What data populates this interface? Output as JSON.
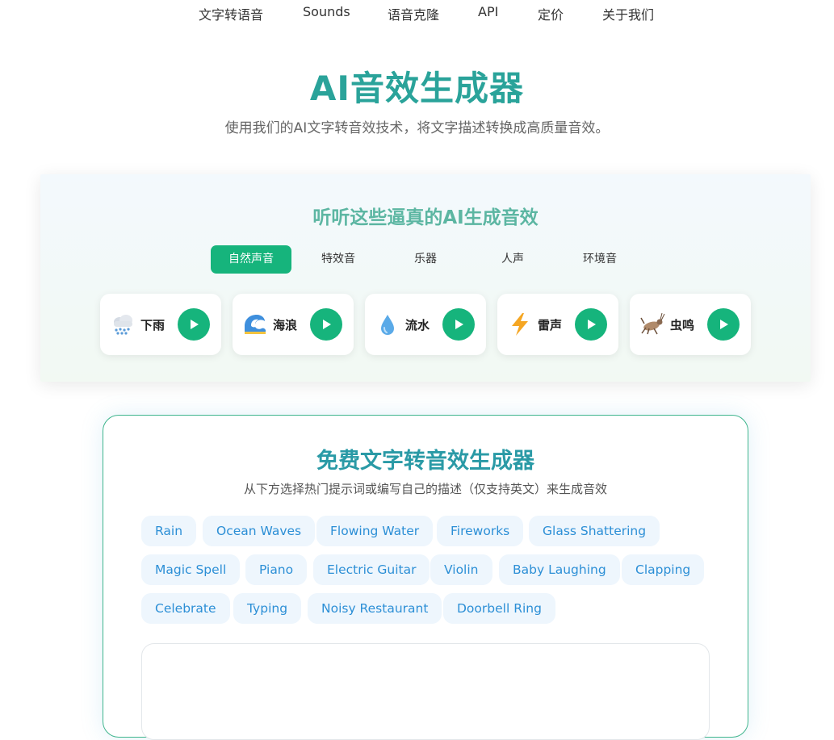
{
  "nav": {
    "items": [
      {
        "label": "文字转语音"
      },
      {
        "label": "Sounds"
      },
      {
        "label": "语音克隆"
      },
      {
        "label": "API"
      },
      {
        "label": "定价"
      },
      {
        "label": "关于我们"
      }
    ]
  },
  "hero": {
    "title": "AI音效生成器",
    "subtitle": "使用我们的AI文字转音效技术，将文字描述转换成高质量音效。"
  },
  "demo": {
    "title": "听听这些逼真的AI生成音效",
    "tabs": [
      {
        "label": "自然声音",
        "active": true
      },
      {
        "label": "特效音",
        "active": false
      },
      {
        "label": "乐器",
        "active": false
      },
      {
        "label": "人声",
        "active": false
      },
      {
        "label": "环境音",
        "active": false
      }
    ],
    "cards": [
      {
        "label": "下雨",
        "icon": "rain-cloud-icon"
      },
      {
        "label": "海浪",
        "icon": "wave-icon"
      },
      {
        "label": "流水",
        "icon": "droplet-icon"
      },
      {
        "label": "雷声",
        "icon": "lightning-icon"
      },
      {
        "label": "虫鸣",
        "icon": "cricket-icon"
      }
    ]
  },
  "generator": {
    "title": "免费文字转音效生成器",
    "subtitle": "从下方选择热门提示词或编写自己的描述（仅支持英文）来生成音效",
    "prompts": [
      "Rain",
      "Ocean Waves",
      "Flowing Water",
      "Fireworks",
      "Glass Shattering",
      "Magic Spell",
      "Piano",
      "Electric Guitar",
      "Violin",
      "Baby Laughing",
      "Clapping",
      "Celebrate",
      "Typing",
      "Noisy Restaurant",
      "Doorbell Ring"
    ]
  },
  "colors": {
    "accent": "#16b47c",
    "title": "#2aa39a",
    "chip_text": "#2c8fd6",
    "chip_bg": "#eef6fd"
  }
}
